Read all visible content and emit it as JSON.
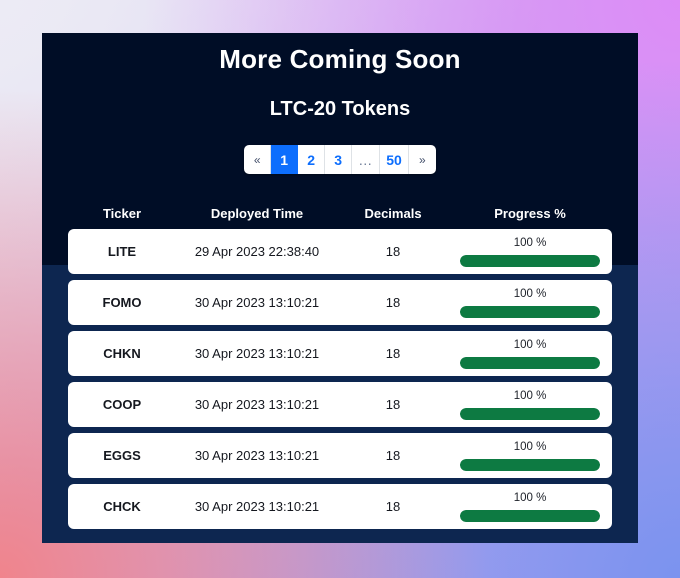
{
  "panel": {
    "title": "More Coming Soon",
    "subtitle": "LTC-20 Tokens",
    "background_color": "#000d26",
    "lower_background_color": "#0d2650"
  },
  "pagination": {
    "prev_label": "«",
    "next_label": "»",
    "ellipsis_label": "…",
    "active_page": "1",
    "active_color": "#0d6efd",
    "pages": [
      "1",
      "2",
      "3"
    ],
    "last_page": "50"
  },
  "table": {
    "columns": [
      "Ticker",
      "Deployed Time",
      "Decimals",
      "Progress %"
    ],
    "progress_color": "#0d7a42",
    "rows": [
      {
        "ticker": "LITE",
        "deployed": "29 Apr 2023 22:38:40",
        "decimals": "18",
        "progress_label": "100 %",
        "progress_value": 100
      },
      {
        "ticker": "FOMO",
        "deployed": "30 Apr 2023 13:10:21",
        "decimals": "18",
        "progress_label": "100 %",
        "progress_value": 100
      },
      {
        "ticker": "CHKN",
        "deployed": "30 Apr 2023 13:10:21",
        "decimals": "18",
        "progress_label": "100 %",
        "progress_value": 100
      },
      {
        "ticker": "COOP",
        "deployed": "30 Apr 2023 13:10:21",
        "decimals": "18",
        "progress_label": "100 %",
        "progress_value": 100
      },
      {
        "ticker": "EGGS",
        "deployed": "30 Apr 2023 13:10:21",
        "decimals": "18",
        "progress_label": "100 %",
        "progress_value": 100
      },
      {
        "ticker": "CHCK",
        "deployed": "30 Apr 2023 13:10:21",
        "decimals": "18",
        "progress_label": "100 %",
        "progress_value": 100
      }
    ]
  }
}
